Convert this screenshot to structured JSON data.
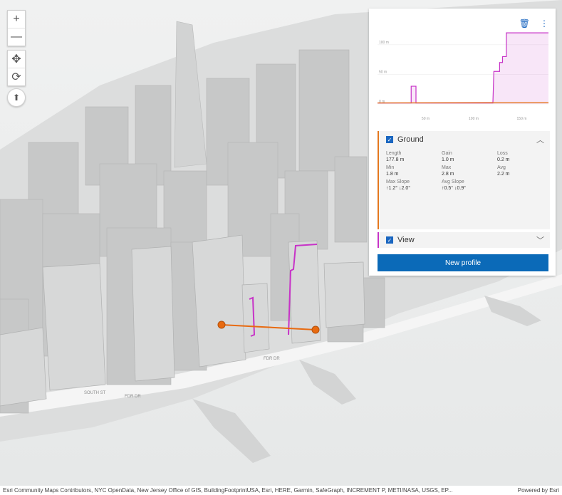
{
  "colors": {
    "ground": "#e5781e",
    "view": "#c733c7",
    "accent": "#0b6ab8",
    "line": "#e86a10"
  },
  "icons": {
    "zoom_in": "plus-icon",
    "zoom_out": "minus-icon",
    "pan": "pan-icon",
    "rotate": "rotate-icon",
    "compass": "compass-icon",
    "delete": "trash-icon",
    "menu": "more-vertical-icon"
  },
  "controls": {
    "zoom_in": "+",
    "zoom_out": "—",
    "pan": "✥",
    "rotate": "⟳",
    "compass": "⬆"
  },
  "map_labels": [
    "SOUTH ST",
    "FDR DR",
    "FDR DR"
  ],
  "chart_data": {
    "type": "line",
    "y_tick_labels": [
      "100 m",
      "50 m",
      "0 m"
    ],
    "x_tick_labels": [
      "50 m",
      "100 m",
      "150 m"
    ],
    "ylim": [
      0,
      125
    ],
    "xlim": [
      0,
      177.8
    ],
    "series": [
      {
        "name": "Ground",
        "color": "#e5781e",
        "points": [
          [
            0,
            1.8
          ],
          [
            177.8,
            2.8
          ]
        ]
      },
      {
        "name": "View",
        "color": "#c733c7",
        "points": [
          [
            0,
            1.8
          ],
          [
            35,
            1.8
          ],
          [
            35,
            30
          ],
          [
            40,
            30
          ],
          [
            40,
            1.8
          ],
          [
            120,
            1.8
          ],
          [
            121,
            55
          ],
          [
            127,
            55
          ],
          [
            127,
            70
          ],
          [
            130,
            70
          ],
          [
            130,
            80
          ],
          [
            134,
            80
          ],
          [
            134,
            120
          ],
          [
            177.8,
            120
          ]
        ]
      }
    ]
  },
  "profile": {
    "ground": {
      "label": "Ground",
      "expanded_icon": "chevron-up-icon",
      "stats": [
        {
          "label": "Length",
          "value": "177.8 m"
        },
        {
          "label": "Gain",
          "value": "1.0 m"
        },
        {
          "label": "Loss",
          "value": "0.2 m"
        },
        {
          "label": "Min",
          "value": "1.8 m"
        },
        {
          "label": "Max",
          "value": "2.8 m"
        },
        {
          "label": "Avg",
          "value": "2.2 m"
        },
        {
          "label": "Max Slope",
          "value": "↑1.2° ↓2.0°"
        },
        {
          "label": "Avg Slope",
          "value": "↑0.5° ↓0.9°"
        }
      ]
    },
    "view": {
      "label": "View",
      "collapsed_icon": "chevron-down-icon"
    },
    "new_profile": "New profile"
  },
  "attribution": {
    "text": "Esri Community Maps Contributors, NYC OpenData, New Jersey Office of GIS, BuildingFootprintUSA, Esri, HERE, Garmin, SafeGraph, INCREMENT P, METI/NASA, USGS, EP...",
    "powered": "Powered by Esri"
  }
}
